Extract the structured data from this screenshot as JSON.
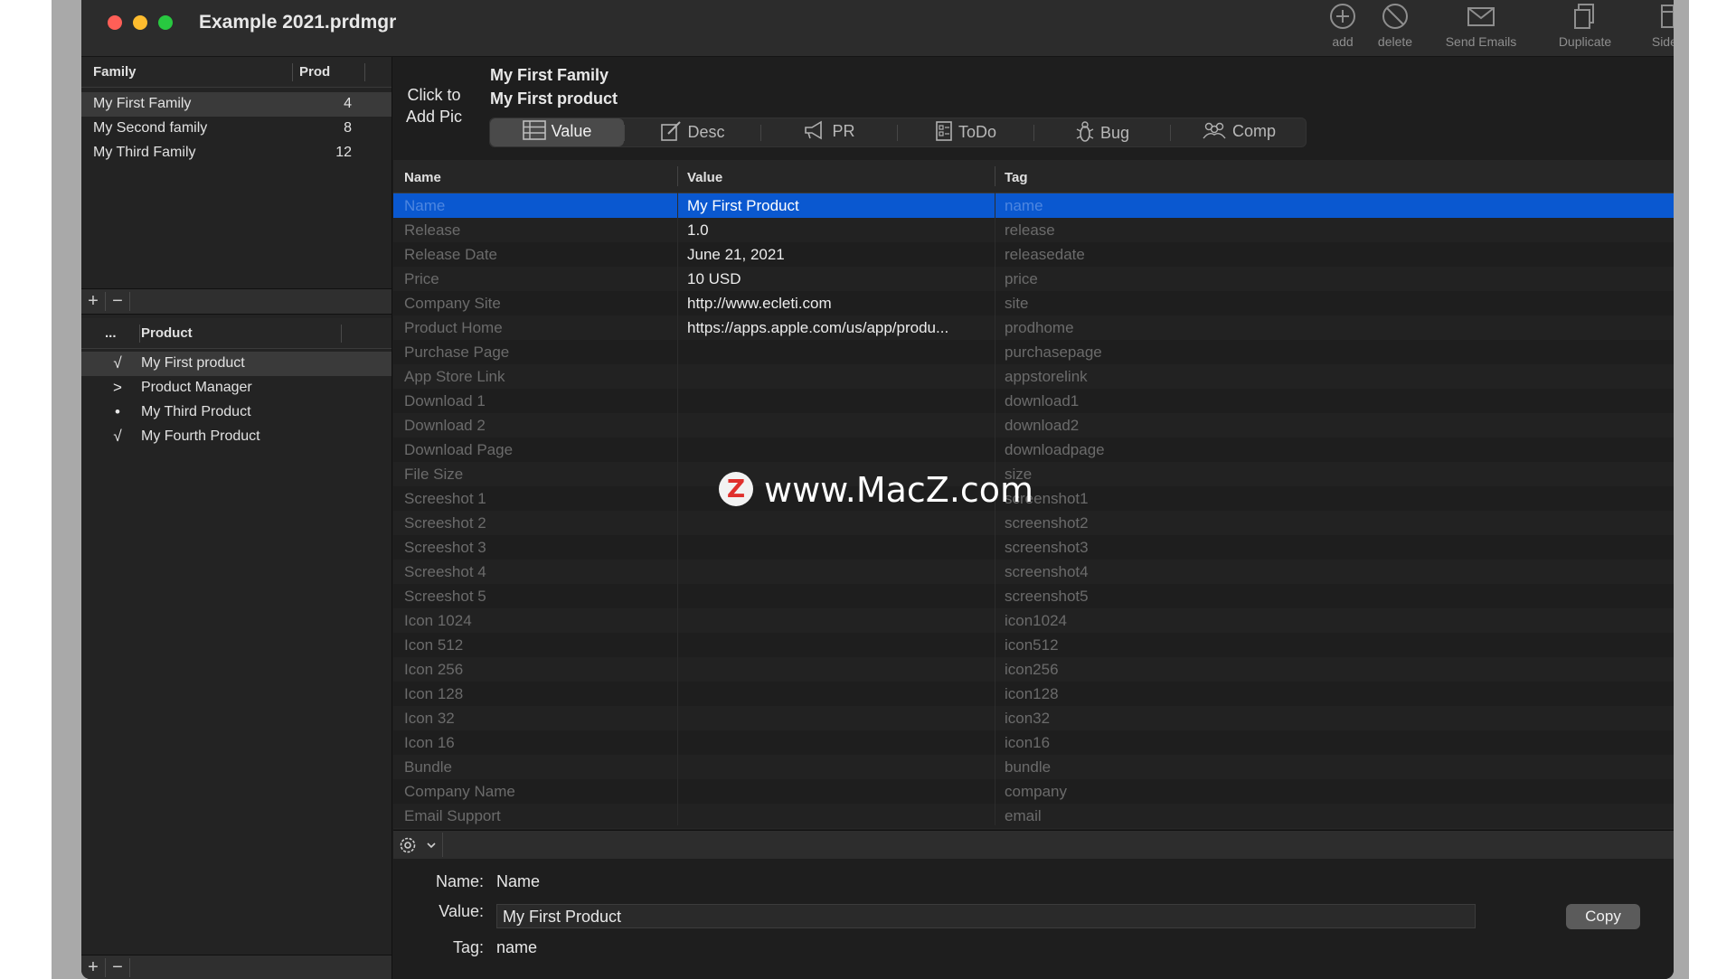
{
  "window": {
    "title": "Example 2021.prdmgr"
  },
  "toolbar": [
    {
      "label": "add",
      "icon": "plus-circle-icon"
    },
    {
      "label": "delete",
      "icon": "prohibited-icon"
    },
    {
      "label": "Send Emails",
      "icon": "envelope-icon"
    },
    {
      "label": "Duplicate",
      "icon": "duplicate-icon"
    },
    {
      "label": "Sidebar",
      "icon": "sidebar-icon"
    }
  ],
  "families": {
    "header": {
      "family": "Family",
      "prod": "Prod"
    },
    "rows": [
      {
        "name": "My First Family",
        "count": "4",
        "selected": true
      },
      {
        "name": "My Second family",
        "count": "8"
      },
      {
        "name": "My Third Family",
        "count": "12"
      }
    ],
    "buttons": {
      "add": "+",
      "remove": "−"
    }
  },
  "products": {
    "header": {
      "status": "...",
      "product": "Product"
    },
    "rows": [
      {
        "mark": "√",
        "name": "My First product",
        "selected": true
      },
      {
        "mark": ">",
        "name": "Product Manager"
      },
      {
        "mark": "•",
        "name": "My Third Product"
      },
      {
        "mark": "√",
        "name": "My Fourth Product"
      }
    ],
    "buttons": {
      "add": "+",
      "remove": "−"
    }
  },
  "header": {
    "add_pic": "Click to Add Pic",
    "family": "My First Family",
    "product": "My First product"
  },
  "tabs": [
    {
      "label": "Value",
      "icon": "list-icon",
      "active": true
    },
    {
      "label": "Desc",
      "icon": "edit-icon"
    },
    {
      "label": "PR",
      "icon": "megaphone-icon"
    },
    {
      "label": "ToDo",
      "icon": "checklist-icon"
    },
    {
      "label": "Bug",
      "icon": "bug-icon"
    },
    {
      "label": "Comp",
      "icon": "people-icon"
    }
  ],
  "table": {
    "columns": [
      "Name",
      "Value",
      "Tag"
    ],
    "rows": [
      {
        "name": "Name",
        "value": "My First Product",
        "tag": "name",
        "selected": true
      },
      {
        "name": "Release",
        "value": "1.0",
        "tag": "release"
      },
      {
        "name": "Release Date",
        "value": "June 21, 2021",
        "tag": "releasedate"
      },
      {
        "name": "Price",
        "value": "10 USD",
        "tag": "price"
      },
      {
        "name": "Company Site",
        "value": "http://www.ecleti.com",
        "tag": "site"
      },
      {
        "name": "Product Home",
        "value": "https://apps.apple.com/us/app/produ...",
        "tag": "prodhome"
      },
      {
        "name": "Purchase Page",
        "value": "",
        "tag": "purchasepage"
      },
      {
        "name": "App Store Link",
        "value": "",
        "tag": "appstorelink"
      },
      {
        "name": "Download 1",
        "value": "",
        "tag": "download1"
      },
      {
        "name": "Download 2",
        "value": "",
        "tag": "download2"
      },
      {
        "name": "Download Page",
        "value": "",
        "tag": "downloadpage"
      },
      {
        "name": "File Size",
        "value": "",
        "tag": "size"
      },
      {
        "name": "Screeshot 1",
        "value": "",
        "tag": "screenshot1"
      },
      {
        "name": "Screeshot 2",
        "value": "",
        "tag": "screenshot2"
      },
      {
        "name": "Screeshot 3",
        "value": "",
        "tag": "screenshot3"
      },
      {
        "name": "Screeshot 4",
        "value": "",
        "tag": "screenshot4"
      },
      {
        "name": "Screeshot 5",
        "value": "",
        "tag": "screenshot5"
      },
      {
        "name": "Icon 1024",
        "value": "",
        "tag": "icon1024"
      },
      {
        "name": "Icon 512",
        "value": "",
        "tag": "icon512"
      },
      {
        "name": "Icon 256",
        "value": "",
        "tag": "icon256"
      },
      {
        "name": "Icon 128",
        "value": "",
        "tag": "icon128"
      },
      {
        "name": "Icon 32",
        "value": "",
        "tag": "icon32"
      },
      {
        "name": "Icon 16",
        "value": "",
        "tag": "icon16"
      },
      {
        "name": "Bundle",
        "value": "",
        "tag": "bundle"
      },
      {
        "name": "Company Name",
        "value": "",
        "tag": "company"
      },
      {
        "name": "Email Support",
        "value": "",
        "tag": "email"
      }
    ]
  },
  "detail": {
    "name_label": "Name:",
    "name_value": "Name",
    "value_label": "Value:",
    "value_value": "My First Product",
    "tag_label": "Tag:",
    "tag_value": "name",
    "copy_label": "Copy"
  },
  "watermark": {
    "logo": "Z",
    "text": "www.MacZ.com"
  },
  "colors": {
    "selection": "#0a58d0",
    "window_bg": "#1e1e1e",
    "close": "#ff5f57",
    "minimize": "#febc2e",
    "zoom": "#28c840"
  }
}
